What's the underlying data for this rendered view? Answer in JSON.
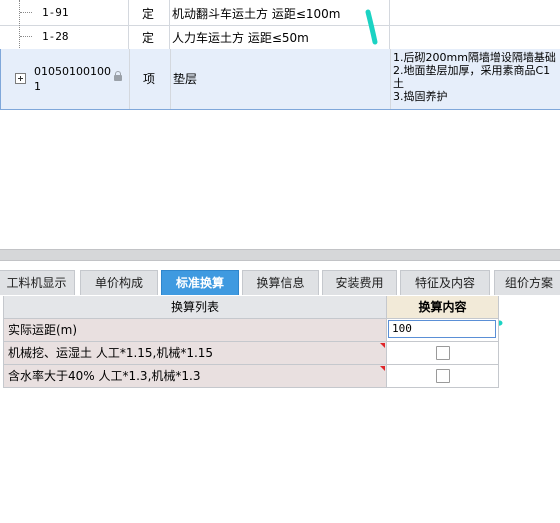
{
  "colors": {
    "accent": "#3f9ae0",
    "annotation": "#1bd3c3",
    "selected_row": "#e6eefa",
    "marker": "#e0262a"
  },
  "top_grid": {
    "rows": [
      {
        "code": "1-91",
        "unit": "定",
        "name": "机动翻斗车运土方 运距≤100m",
        "desc": ""
      },
      {
        "code": "1-28",
        "unit": "定",
        "name": "人力车运土方 运距≤50m",
        "desc": ""
      }
    ],
    "selected_row": {
      "code_line1": "01050100100",
      "code_line2": "1",
      "unit": "项",
      "name": "垫层",
      "desc_lines": [
        "1.后砌200mm隔墙增设隔墙基础",
        "2.地面垫层加厚，采用素商品C1",
        "土",
        "3.捣固养护"
      ]
    }
  },
  "tabs": [
    {
      "label": "工料机显示"
    },
    {
      "label": "单价构成"
    },
    {
      "label": "标准换算",
      "active": true
    },
    {
      "label": "换算信息"
    },
    {
      "label": "安装费用"
    },
    {
      "label": "特征及内容"
    },
    {
      "label": "组价方案"
    }
  ],
  "conversion": {
    "col_list": "换算列表",
    "col_content": "换算内容",
    "rows": [
      {
        "label": "实际运距(m)",
        "type": "input",
        "value": "100"
      },
      {
        "label": "机械挖、运湿土 人工*1.15,机械*1.15",
        "type": "checkbox",
        "checked": false
      },
      {
        "label": "含水率大于40% 人工*1.3,机械*1.3",
        "type": "checkbox",
        "checked": false
      }
    ]
  }
}
